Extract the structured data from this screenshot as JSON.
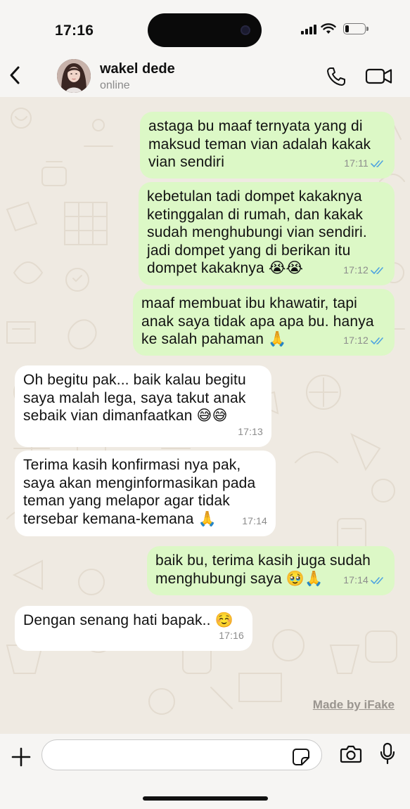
{
  "status_bar": {
    "time": "17:16",
    "battery_level": 0.2
  },
  "header": {
    "contact_name": "wakel dede",
    "contact_status": "online",
    "icons": [
      "back-icon",
      "phone-icon",
      "video-icon"
    ]
  },
  "messages": [
    {
      "direction": "out",
      "text": "astaga bu maaf ternyata yang di\nmaksud teman vian adalah kakak\nvian sendiri",
      "time": "17:11",
      "read": true
    },
    {
      "direction": "out",
      "text": "kebetulan tadi dompet kakaknya\nketinggalan di rumah, dan kakak\nsudah menghubungi vian sendiri.\njadi dompet yang di berikan itu\ndompet kakaknya 😭😭",
      "time": "17:12",
      "read": true
    },
    {
      "direction": "out",
      "text": "maaf membuat ibu khawatir, tapi\nanak saya tidak apa apa bu. hanya\nke salah pahaman 🙏",
      "time": "17:12",
      "read": true
    },
    {
      "direction": "in",
      "text": "Oh begitu pak... baik kalau begitu\nsaya malah lega, saya takut anak\nsebaik vian dimanfaatkan 😅😅",
      "time": "17:13"
    },
    {
      "direction": "in",
      "text": "Terima kasih konfirmasi nya pak,\nsaya akan menginformasikan pada\nteman yang melapor agar tidak\ntersebar kemana-kemana 🙏",
      "time": "17:14"
    },
    {
      "direction": "out",
      "text": "baik bu, terima kasih juga sudah\nmenghubungi saya 🥹🙏",
      "time": "17:14",
      "read": true
    },
    {
      "direction": "in",
      "text": "Dengan senang hati bapak.. ☺️",
      "time": "17:16"
    }
  ],
  "watermark": "Made by iFake",
  "composer": {
    "placeholder": "",
    "value": ""
  },
  "colors": {
    "outgoing_bubble": "#dcf8c6",
    "incoming_bubble": "#ffffff",
    "background": "#efeae2",
    "read_ticks": "#4fa3e0"
  }
}
